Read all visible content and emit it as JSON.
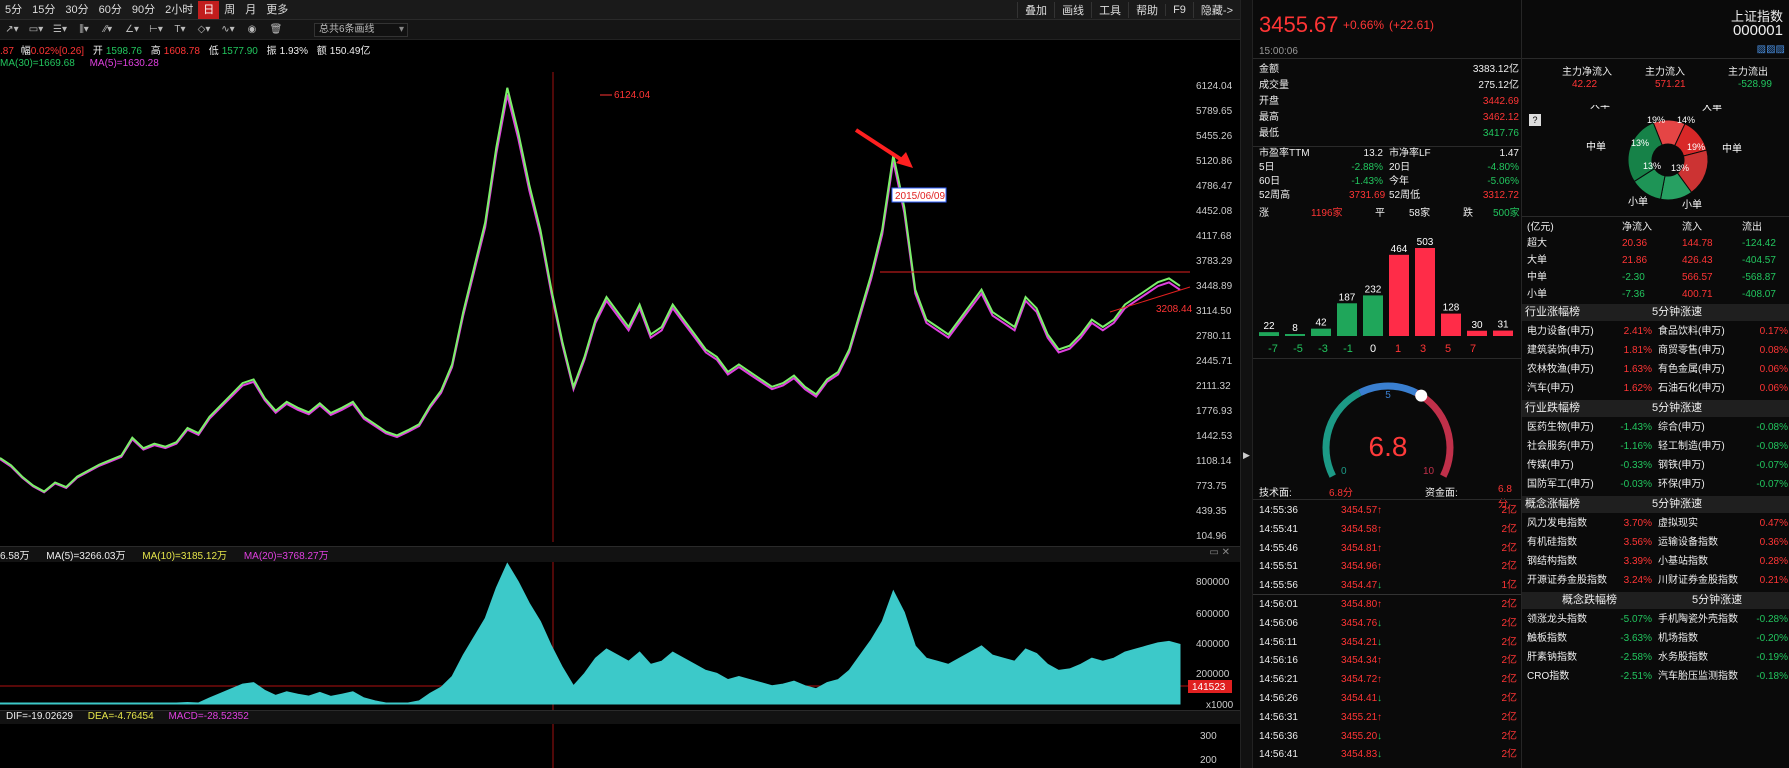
{
  "toolbar": {
    "periods": [
      "5分",
      "15分",
      "30分",
      "60分",
      "90分",
      "2小时",
      "日",
      "周",
      "月",
      "更多"
    ],
    "active_period": "日",
    "right_items": [
      "叠加",
      "画线",
      "工具",
      "帮助",
      "F9",
      "隐藏->"
    ],
    "draw_select": "总共6条画线"
  },
  "info": {
    "prefix": ".87",
    "amp_label": "幅",
    "amp": "0.02%[0.26]",
    "open_label": "开",
    "open": "1598.76",
    "high_label": "高",
    "high": "1608.78",
    "low_label": "低",
    "low": "1577.90",
    "swing_label": "振",
    "swing": "1.93%",
    "amount_label": "额",
    "amount": "150.49亿"
  },
  "ma": {
    "ma30": "MA(30)=1669.68",
    "ma5": "MA(5)=1630.28"
  },
  "chart_data": [
    {
      "type": "line",
      "title": "",
      "y_ticks": [
        "6124.04",
        "5789.65",
        "5455.26",
        "5120.86",
        "4786.47",
        "4452.08",
        "4117.68",
        "3783.29",
        "3448.89",
        "3114.50",
        "2780.11",
        "2445.71",
        "2111.32",
        "1776.93",
        "1442.53",
        "1108.14",
        "773.75",
        "439.35",
        "104.96"
      ],
      "ylim": [
        104.96,
        6124.04
      ],
      "series": [
        {
          "values": [
            1150,
            1050,
            900,
            780,
            700,
            820,
            760,
            900,
            980,
            1060,
            1120,
            1180,
            1420,
            1280,
            1340,
            1300,
            1360,
            1550,
            1480,
            1700,
            1850,
            2000,
            2150,
            2200,
            1950,
            1780,
            1900,
            1820,
            1760,
            1880,
            1750,
            1820,
            1900,
            1700,
            1600,
            1500,
            1450,
            1520,
            1600,
            1850,
            2050,
            2400,
            3100,
            3700,
            4300,
            5300,
            6100,
            5500,
            4800,
            4200,
            3400,
            2700,
            2100,
            2500,
            3000,
            3300,
            3100,
            2900,
            3200,
            2800,
            2900,
            3200,
            3000,
            2800,
            2600,
            2500,
            2300,
            2400,
            2300,
            2200,
            2100,
            2150,
            2250,
            2100,
            2000,
            2200,
            2300,
            2600,
            3100,
            3600,
            4200,
            5200,
            4500,
            3400,
            3000,
            2900,
            2800,
            3000,
            3200,
            3400,
            3100,
            3000,
            2900,
            3300,
            3150,
            2800,
            2600,
            2650,
            2800,
            3000,
            2900,
            3000,
            3200,
            3300,
            3400,
            3500,
            3550,
            3450
          ]
        }
      ],
      "annotations": [
        "6124.04",
        "2015/06/09",
        "3208.44"
      ]
    },
    {
      "type": "bar",
      "title": "",
      "y_ticks": [
        "800000",
        "600000",
        "400000",
        "200000"
      ],
      "unit": "x1000",
      "last_value": "141523"
    },
    {
      "type": "line",
      "title": "",
      "y_ticks": [
        "300",
        "200"
      ]
    }
  ],
  "vol": {
    "prefix": "6.58万",
    "ma5": "MA(5)=3266.03万",
    "ma10": "MA(10)=3185.12万",
    "ma20": "MA(20)=3768.27万"
  },
  "macd": {
    "dif": "DIF=-19.02629",
    "dea": "DEA=-4.76454",
    "macd": "MACD=-28.52352"
  },
  "quote": {
    "price": "3455.67",
    "pct": "+0.66%",
    "change": "(+22.61)",
    "time": "15:00:06",
    "name": "上证指数",
    "code": "000001"
  },
  "stats": [
    {
      "label": "金额",
      "value": "3383.12亿",
      "color": "white"
    },
    {
      "label": "成交量",
      "value": "275.12亿",
      "color": "white"
    },
    {
      "label": "开盘",
      "value": "3442.69",
      "color": "red"
    },
    {
      "label": "最高",
      "value": "3462.12",
      "color": "red"
    },
    {
      "label": "最低",
      "value": "3417.76",
      "color": "green"
    }
  ],
  "stats2": [
    {
      "l1": "市盈率TTM",
      "v1": "13.2",
      "l2": "市净率LF",
      "v2": "1.47",
      "c1": "white",
      "c2": "white"
    },
    {
      "l1": "5日",
      "v1": "-2.88%",
      "l2": "20日",
      "v2": "-4.80%",
      "c1": "green",
      "c2": "green"
    },
    {
      "l1": "60日",
      "v1": "-1.43%",
      "l2": "今年",
      "v2": "-5.06%",
      "c1": "green",
      "c2": "green"
    },
    {
      "l1": "52周高",
      "v1": "3731.69",
      "l2": "52周低",
      "v2": "3312.72",
      "c1": "red",
      "c2": "red"
    }
  ],
  "breadth": {
    "up_label": "涨",
    "up": "1196家",
    "flat_label": "平",
    "flat": "58家",
    "down_label": "跌",
    "down": "500家"
  },
  "dist": {
    "labels": [
      "-7",
      "-5",
      "-3",
      "-1",
      "0",
      "1",
      "3",
      "5",
      "7"
    ],
    "values": [
      22,
      8,
      42,
      187,
      232,
      464,
      503,
      128,
      30,
      31
    ],
    "colors": [
      "green",
      "green",
      "green",
      "green",
      "green",
      "red",
      "red",
      "red",
      "red",
      "red"
    ]
  },
  "gauge": {
    "value": "6.8",
    "mark_top": "5",
    "mark_left": "0",
    "mark_right": "10",
    "tech_label": "技术面:",
    "tech": "6.8分",
    "fund_label": "资金面:",
    "fund": "6.8分"
  },
  "ticks": [
    {
      "t": "14:55:36",
      "p": "3454.57",
      "d": "up",
      "v": "2亿"
    },
    {
      "t": "14:55:41",
      "p": "3454.58",
      "d": "up",
      "v": "2亿"
    },
    {
      "t": "14:55:46",
      "p": "3454.81",
      "d": "up",
      "v": "2亿"
    },
    {
      "t": "14:55:51",
      "p": "3454.96",
      "d": "up",
      "v": "2亿"
    },
    {
      "t": "14:55:56",
      "p": "3454.47",
      "d": "down",
      "v": "1亿"
    },
    {
      "t": "14:56:01",
      "p": "3454.80",
      "d": "up",
      "v": "2亿"
    },
    {
      "t": "14:56:06",
      "p": "3454.76",
      "d": "down",
      "v": "2亿"
    },
    {
      "t": "14:56:11",
      "p": "3454.21",
      "d": "down",
      "v": "2亿"
    },
    {
      "t": "14:56:16",
      "p": "3454.34",
      "d": "up",
      "v": "2亿"
    },
    {
      "t": "14:56:21",
      "p": "3454.72",
      "d": "up",
      "v": "2亿"
    },
    {
      "t": "14:56:26",
      "p": "3454.41",
      "d": "down",
      "v": "2亿"
    },
    {
      "t": "14:56:31",
      "p": "3455.21",
      "d": "up",
      "v": "2亿"
    },
    {
      "t": "14:56:36",
      "p": "3455.20",
      "d": "down",
      "v": "2亿"
    },
    {
      "t": "14:56:41",
      "p": "3454.83",
      "d": "down",
      "v": "2亿"
    }
  ],
  "flow": {
    "hdr": [
      "主力净流入",
      "主力流入",
      "主力流出"
    ],
    "vals": [
      "42.22",
      "571.21",
      "-528.99"
    ],
    "q": "?",
    "pie_labels": [
      "大单",
      "大单",
      "中单",
      "中单",
      "小单",
      "小单"
    ],
    "pie_pcts": [
      "13%",
      "14%",
      "19%",
      "19%",
      "13%",
      "13%"
    ]
  },
  "flowtable": {
    "hdr": [
      "(亿元)",
      "净流入",
      "流入",
      "流出"
    ],
    "rows": [
      [
        "超大",
        "20.36",
        "144.78",
        "-124.42"
      ],
      [
        "大单",
        "21.86",
        "426.43",
        "-404.57"
      ],
      [
        "中单",
        "-2.30",
        "566.57",
        "-568.87"
      ],
      [
        "小单",
        "-7.36",
        "400.71",
        "-408.07"
      ]
    ]
  },
  "sections": [
    {
      "title": "行业涨幅榜",
      "title2": "5分钟涨速",
      "rows": [
        [
          "电力设备(申万)",
          "2.41%",
          "red",
          "食品饮料(申万)",
          "0.17%",
          "red"
        ],
        [
          "建筑装饰(申万)",
          "1.81%",
          "red",
          "商贸零售(申万)",
          "0.08%",
          "red"
        ],
        [
          "农林牧渔(申万)",
          "1.63%",
          "red",
          "有色金属(申万)",
          "0.06%",
          "red"
        ],
        [
          "汽车(申万)",
          "1.62%",
          "red",
          "石油石化(申万)",
          "0.06%",
          "red"
        ]
      ]
    },
    {
      "title": "行业跌幅榜",
      "title2": "5分钟涨速",
      "rows": [
        [
          "医药生物(申万)",
          "-1.43%",
          "green",
          "综合(申万)",
          "-0.08%",
          "green"
        ],
        [
          "社会服务(申万)",
          "-1.16%",
          "green",
          "轻工制造(申万)",
          "-0.08%",
          "green"
        ],
        [
          "传媒(申万)",
          "-0.33%",
          "green",
          "钢铁(申万)",
          "-0.07%",
          "green"
        ],
        [
          "国防军工(申万)",
          "-0.03%",
          "green",
          "环保(申万)",
          "-0.07%",
          "green"
        ]
      ]
    },
    {
      "title": "概念涨幅榜",
      "title2": "5分钟涨速",
      "rows": [
        [
          "风力发电指数",
          "3.70%",
          "red",
          "虚拟现实",
          "0.47%",
          "red"
        ],
        [
          "有机硅指数",
          "3.56%",
          "red",
          "运输设备指数",
          "0.36%",
          "red"
        ],
        [
          "钢结构指数",
          "3.39%",
          "red",
          "小基站指数",
          "0.28%",
          "red"
        ],
        [
          "开源证券金股指数",
          "3.24%",
          "red",
          "川财证券金股指数",
          "0.21%",
          "red"
        ]
      ]
    },
    {
      "title": "概念跌幅榜",
      "title2": "5分钟涨速",
      "rows": [
        [
          "领涨龙头指数",
          "-5.07%",
          "green",
          "手机陶瓷外壳指数",
          "-0.28%",
          "green"
        ],
        [
          "触板指数",
          "-3.63%",
          "green",
          "机场指数",
          "-0.20%",
          "green"
        ],
        [
          "肝素钠指数",
          "-2.58%",
          "green",
          "水务股指数",
          "-0.19%",
          "green"
        ],
        [
          "CRO指数",
          "-2.51%",
          "green",
          "汽车胎压监测指数",
          "-0.18%",
          "green"
        ]
      ]
    }
  ]
}
